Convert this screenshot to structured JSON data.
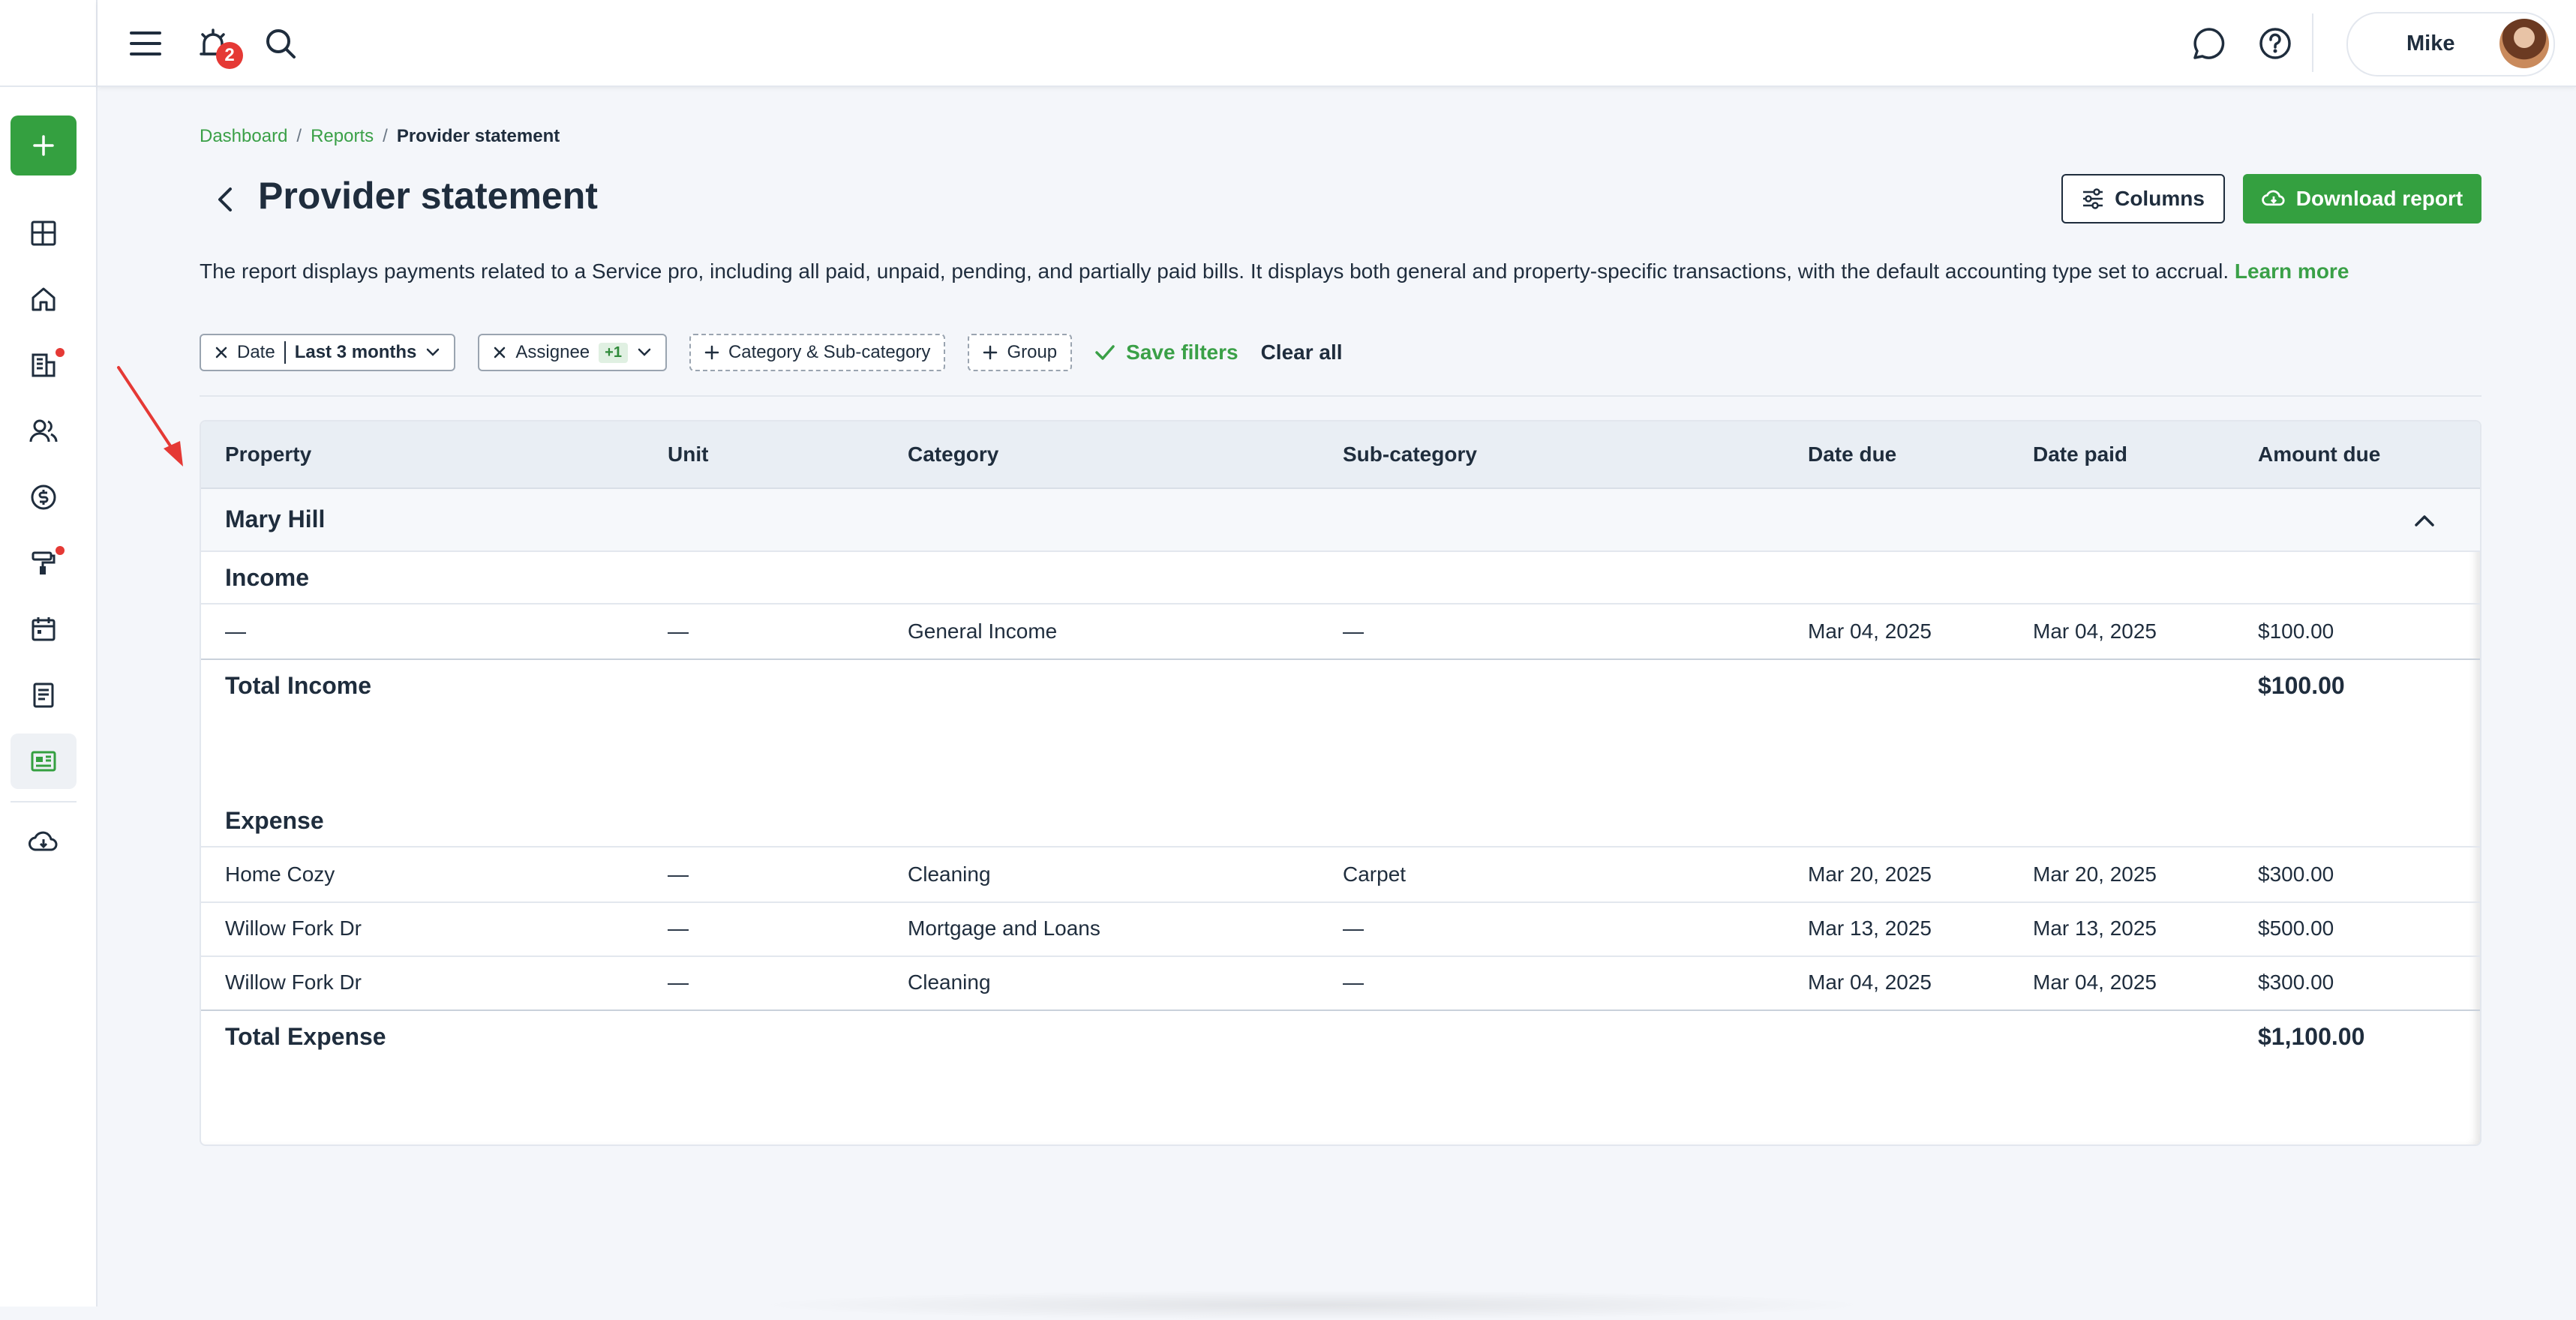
{
  "topbar": {
    "notification_count": "2",
    "user_name": "Mike"
  },
  "breadcrumb": {
    "items": [
      "Dashboard",
      "Reports"
    ],
    "separator": "/",
    "current": "Provider statement"
  },
  "page": {
    "title": "Provider statement",
    "columns_label": "Columns",
    "download_label": "Download report",
    "description": "The report displays payments related to a Service pro, including all paid, unpaid, pending, and partially paid bills. It displays both general and property-specific transactions, with the default accounting type set to accrual.",
    "learn_more": "Learn more"
  },
  "filters": {
    "date_label": "Date",
    "date_value": "Last 3 months",
    "assignee_label": "Assignee",
    "assignee_count": "+1",
    "category_label": "Category & Sub-category",
    "group_label": "Group",
    "save_filters": "Save filters",
    "clear_all": "Clear all"
  },
  "table": {
    "headers": [
      "Property",
      "Unit",
      "Category",
      "Sub-category",
      "Date due",
      "Date paid",
      "Amount due"
    ],
    "group_name": "Mary Hill",
    "income": {
      "title": "Income",
      "rows": [
        [
          "—",
          "—",
          "General Income",
          "—",
          "Mar 04, 2025",
          "Mar 04, 2025",
          "$100.00"
        ]
      ],
      "total_label": "Total Income",
      "total_value": "$100.00"
    },
    "expense": {
      "title": "Expense",
      "rows": [
        [
          "Home Cozy",
          "—",
          "Cleaning",
          "Carpet",
          "Mar 20, 2025",
          "Mar 20, 2025",
          "$300.00"
        ],
        [
          "Willow Fork Dr",
          "—",
          "Mortgage and Loans",
          "—",
          "Mar 13, 2025",
          "Mar 13, 2025",
          "$500.00"
        ],
        [
          "Willow Fork Dr",
          "—",
          "Cleaning",
          "—",
          "Mar 04, 2025",
          "Mar 04, 2025",
          "$300.00"
        ]
      ],
      "total_label": "Total Expense",
      "total_value": "$1,100.00"
    }
  },
  "icons": {
    "sidebar": [
      "plus-icon",
      "dashboard-icon",
      "home-icon",
      "building-icon",
      "people-icon",
      "dollar-icon",
      "paint-roller-icon",
      "calendar-icon",
      "document-icon",
      "report-icon",
      "cloud-download-icon"
    ],
    "accent_color": "#34a040",
    "alert_color": "#e53935"
  }
}
